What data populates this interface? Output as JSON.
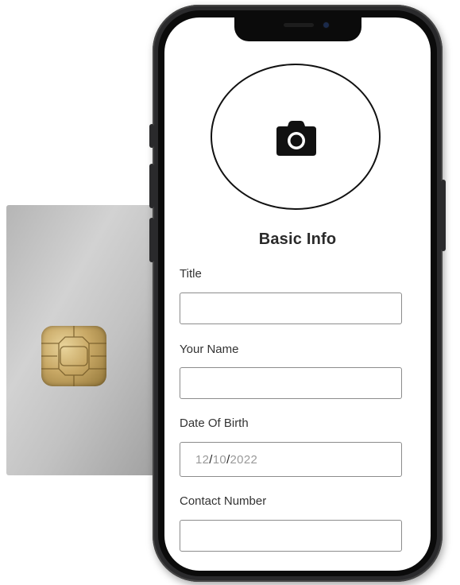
{
  "form": {
    "heading": "Basic Info",
    "fields": [
      {
        "label": "Title",
        "value": ""
      },
      {
        "label": "Your Name",
        "value": ""
      },
      {
        "label": "Date Of Birth",
        "month": "12",
        "day": "10",
        "year": "2022",
        "separator": "/"
      },
      {
        "label": "Contact Number",
        "value": ""
      }
    ]
  },
  "icons": {
    "profile_photo": "camera-icon",
    "card_chip": "sim-chip-icon"
  },
  "colors": {
    "screen_bg": "#ffffff",
    "phone_frame": "#2a2a2c",
    "field_border": "#8c8c8c",
    "card": "#c2c2c2",
    "chip": "#c8a865"
  }
}
